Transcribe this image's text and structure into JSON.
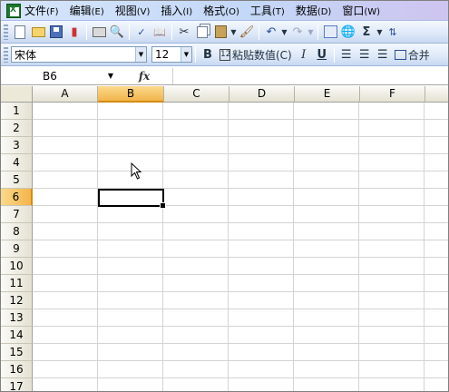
{
  "menubar": {
    "items": [
      {
        "label": "文件",
        "key": "(F)"
      },
      {
        "label": "编辑",
        "key": "(E)"
      },
      {
        "label": "视图",
        "key": "(V)"
      },
      {
        "label": "插入",
        "key": "(I)"
      },
      {
        "label": "格式",
        "key": "(O)"
      },
      {
        "label": "工具",
        "key": "(T)"
      },
      {
        "label": "数据",
        "key": "(D)"
      },
      {
        "label": "窗口",
        "key": "(W)"
      }
    ]
  },
  "format_toolbar": {
    "font_name": "宋体",
    "font_size": "12",
    "bold": "B",
    "paste_values": "粘贴数值(C)",
    "italic": "I",
    "underline": "U",
    "merge": "合并"
  },
  "standard_toolbar": {
    "sum": "Σ"
  },
  "formula_bar": {
    "name_box": "B6",
    "fx": "fx"
  },
  "grid": {
    "columns": [
      "A",
      "B",
      "C",
      "D",
      "E",
      "F"
    ],
    "rows": [
      "1",
      "2",
      "3",
      "4",
      "5",
      "6",
      "7",
      "8",
      "9",
      "10",
      "11",
      "12",
      "13",
      "14",
      "15",
      "16",
      "17"
    ],
    "selected_column": "B",
    "selected_row": "6"
  },
  "colors": {
    "selection_header": "#f3b54c",
    "menubar": "#c4d8f7"
  }
}
